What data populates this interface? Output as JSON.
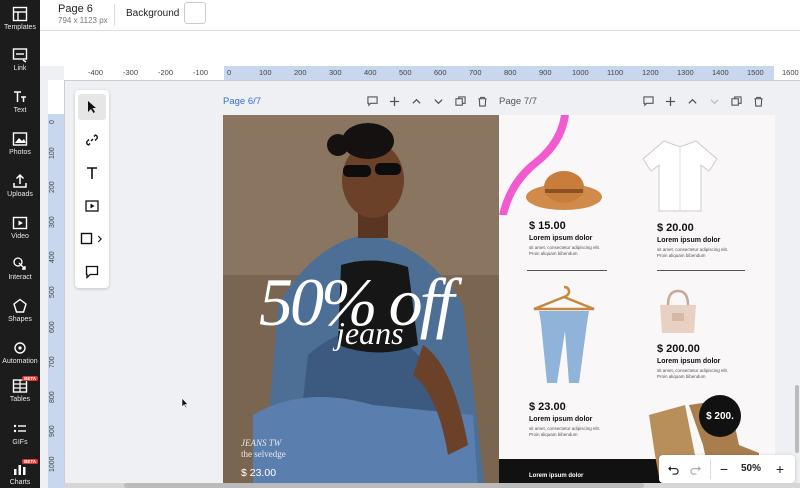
{
  "sidebar": {
    "items": [
      {
        "label": "Templates",
        "icon": "templates-icon"
      },
      {
        "label": "Link",
        "icon": "link-icon"
      },
      {
        "label": "Text",
        "icon": "text-icon"
      },
      {
        "label": "Photos",
        "icon": "photos-icon"
      },
      {
        "label": "Uploads",
        "icon": "uploads-icon"
      },
      {
        "label": "Video",
        "icon": "video-icon"
      },
      {
        "label": "Interact",
        "icon": "interact-icon"
      },
      {
        "label": "Shapes",
        "icon": "shapes-icon"
      },
      {
        "label": "Automation",
        "icon": "automation-icon",
        "badge": "BETA"
      },
      {
        "label": "Tables",
        "icon": "tables-icon",
        "badge": "BETA"
      },
      {
        "label": "GIFs",
        "icon": "gifs-icon"
      },
      {
        "label": "Charts",
        "icon": "charts-icon",
        "badge": "BETA"
      }
    ]
  },
  "header": {
    "page_title": "Page 6",
    "page_size": "794 x 1123 px",
    "background_label": "Background",
    "background_color": "#ffffff"
  },
  "ruler": {
    "horizontal": [
      "-400",
      "-300",
      "-200",
      "-100",
      "0",
      "100",
      "200",
      "300",
      "400",
      "500",
      "600",
      "700",
      "800",
      "900",
      "1000",
      "1100",
      "1200",
      "1300",
      "1400",
      "1500",
      "1600"
    ],
    "vertical": [
      "0",
      "100",
      "200",
      "300",
      "400",
      "500",
      "600",
      "700",
      "800",
      "900",
      "1000",
      "1100"
    ]
  },
  "tools": [
    "select-tool",
    "link-tool",
    "text-tool",
    "video-tool",
    "shape-tool",
    "comment-tool"
  ],
  "pages": {
    "page6": {
      "label": "Page 6/7",
      "headline": "50% off",
      "subheadline": "jeans",
      "brand_line1": "JEANS TW",
      "brand_line2": "the selvedge",
      "price": "$ 23.00"
    },
    "page7": {
      "label": "Page 7/7",
      "products": [
        {
          "price": "$ 15.00",
          "name": "Lorem ipsum dolor",
          "desc": "sit amet, consectetur adipiscing elit. Proin aliquam bibendum",
          "icon": "hat-image"
        },
        {
          "price": "$ 20.00",
          "name": "Lorem ipsum dolor",
          "desc": "sit amet, consectetur adipiscing elit. Proin aliquam bibendum",
          "icon": "shirt-image"
        },
        {
          "price": "",
          "name": "",
          "desc": "",
          "icon": "jeans-image"
        },
        {
          "price": "$ 200.00",
          "name": "Lorem ipsum dolor",
          "desc": "sit amet, consectetur adipiscing elit. Proin aliquam bibendum",
          "icon": "handbag-image"
        },
        {
          "price": "$ 23.00",
          "name": "Lorem ipsum dolor",
          "desc": "sit amet, consectetur adipiscing elit. Proin aliquam bibendum",
          "icon": "boots-image"
        }
      ],
      "badge_price": "$ 200.",
      "footer": "Lorem ipsum dolor"
    }
  },
  "zoom": {
    "value": "50%",
    "minus": "−",
    "plus": "+"
  },
  "colors": {
    "accent": "#3b6fd4",
    "sidebar": "#1c1c1c",
    "ruler_highlight": "#c9d7ee",
    "ribbon": "#f25bd0"
  }
}
